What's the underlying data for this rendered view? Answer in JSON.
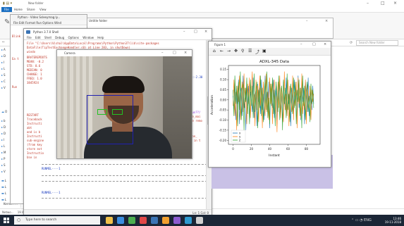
{
  "explorer": {
    "title": "New folder",
    "ribbon_tabs": [
      "File",
      "Home",
      "Share",
      "View"
    ],
    "search_placeholder": "Search New folder",
    "nav_items": [
      "A",
      "D",
      "I",
      "L",
      "S",
      "C",
      "V",
      "b",
      "D",
      "D",
      "I",
      "L",
      "M",
      "P",
      "S",
      "V",
      "O",
      "C",
      "D",
      "S",
      "L",
      "L",
      "L",
      "L",
      "L"
    ],
    "status_text": "19 items  1 item",
    "extra_labels": [
      "Kernel ???",
      "Netwo..."
    ]
  },
  "idle": {
    "title": "Python - Video Ssleeymag.ly...",
    "menu": "File  Edit  Format  Run  Options  Wind",
    "side_text": [
      "Blink",
      "Ea t",
      "Run"
    ]
  },
  "small_window": {
    "title": "Untitle folder"
  },
  "shell": {
    "title": "Python 3.7.0 Shell",
    "menu": [
      "File",
      "Edit",
      "Shell",
      "Debug",
      "Options",
      "Window",
      "Help"
    ],
    "lines": [
      "File \"C:\\Users\\Vishal\\AppData\\Local\\Programs\\Python\\Python37\\lib\\site-packages",
      "DataFile(TipTestExchangeHandler.c0) at Line 283, in shutDown)",
      "   windo",
      "BRATEREPDOTS",
      "MEAN: -0.2",
      "STD: 0.6",
      "MEDIAN: 0",
      "CHANGE: 1",
      "FREQ: 1.0",
      "3845924",
      "RESTART",
      "Traceback",
      "Instructi",
      "abt",
      "and is b",
      "Instructi",
      "sub-engine",
      "(from key",
      "store ext",
      "Instructio",
      "Use in",
      "RESTART: C",
      "RESTART: C"
    ],
    "right_fragments": [
      "el:-2.30",
      "bus??/",
      "le_mai",
      "he remo",
      "ion_",
      "s in t"
    ],
    "prompt_1": "RUNMEL----1",
    "prompt_2": "RUNMEL----1",
    "status": "Ln: 1  Col: 0"
  },
  "camera": {
    "title": "Camera"
  },
  "figure": {
    "title": "Figure 1",
    "toolbar_icons": [
      "home-icon",
      "back-icon",
      "forward-icon",
      "pan-icon",
      "zoom-icon",
      "configure-icon",
      "edit-curve-icon",
      "save-icon"
    ],
    "toolbar_glyphs": [
      "⌂",
      "←",
      "→",
      "✥",
      "⚲",
      "☰",
      "⤴",
      "▣"
    ]
  },
  "chart_data": {
    "type": "line",
    "title": "ADXL-345 Data",
    "xlabel": "Instant",
    "ylabel": "Acceleration",
    "xlim": [
      -5,
      95
    ],
    "ylim": [
      -0.22,
      0.17
    ],
    "xticks": [
      0,
      20,
      40,
      60,
      80
    ],
    "yticks": [
      -0.2,
      -0.15,
      -0.1,
      -0.05,
      0.0,
      0.05,
      0.1,
      0.15
    ],
    "ytick_labels": [
      "-0.20",
      "-0.15",
      "-0.10",
      "-0.05",
      "0.00",
      "0.05",
      "0.10",
      "0.15"
    ],
    "legend_position": "bottom-left",
    "series": [
      {
        "name": "x",
        "color": "#1f77b4",
        "values": [
          0.02,
          -0.05,
          0.08,
          -0.1,
          0.05,
          -0.02,
          0.1,
          -0.12,
          0.03,
          0.06,
          -0.08,
          0.12,
          -0.04,
          0.01,
          -0.15,
          0.09,
          -0.03,
          0.07,
          -0.11,
          0.04,
          0.0,
          -0.06,
          0.11,
          -0.09,
          0.02,
          0.05,
          -0.13,
          0.08,
          -0.01,
          0.06,
          -0.07,
          0.1,
          -0.05,
          0.03,
          -0.1,
          0.12,
          -0.02,
          0.04,
          -0.08,
          0.09,
          -0.14,
          0.06,
          0.01,
          -0.04,
          0.1,
          -0.09,
          0.03,
          0.07,
          -0.12,
          0.05,
          -0.01,
          0.08,
          -0.06,
          0.02,
          -0.11,
          0.09,
          0.0,
          -0.05,
          0.11,
          -0.08,
          0.04,
          -0.02,
          0.07,
          -0.13,
          0.06,
          0.01,
          -0.07,
          0.1,
          -0.03,
          0.05,
          -0.09,
          0.12,
          -0.04,
          0.02,
          -0.1,
          0.08,
          -0.01,
          0.06,
          -0.12,
          0.09,
          0.03,
          -0.06,
          0.11,
          -0.08,
          0.04,
          0.0,
          -0.05,
          0.07,
          -0.02
        ]
      },
      {
        "name": "y",
        "color": "#ff7f0e",
        "values": [
          -0.03,
          0.1,
          -0.08,
          0.04,
          -0.15,
          0.07,
          -0.01,
          0.12,
          -0.1,
          0.02,
          0.09,
          -0.06,
          0.13,
          -0.04,
          0.06,
          -0.12,
          0.08,
          -0.02,
          0.11,
          -0.09,
          0.05,
          0.14,
          -0.07,
          0.03,
          -0.13,
          0.1,
          -0.05,
          0.07,
          -0.11,
          0.12,
          -0.03,
          0.06,
          -0.14,
          0.09,
          0.01,
          -0.08,
          0.13,
          -0.06,
          0.04,
          -0.1,
          0.11,
          -0.02,
          0.08,
          -0.12,
          0.05,
          0.1,
          -0.07,
          0.02,
          -0.16,
          0.09,
          -0.04,
          0.12,
          -0.09,
          0.06,
          0.01,
          -0.11,
          0.14,
          -0.05,
          0.03,
          -0.08,
          0.1,
          -0.13,
          0.07,
          0.0,
          -0.06,
          0.12,
          -0.1,
          0.04,
          -0.03,
          0.09,
          -0.14,
          0.11,
          -0.02,
          0.06,
          -0.09,
          0.13,
          -0.07,
          0.02,
          -0.05,
          0.1,
          -0.12,
          0.08,
          0.01,
          -0.04,
          0.07,
          -0.1,
          0.05,
          -0.01,
          0.03
        ]
      },
      {
        "name": "z",
        "color": "#2ca02c",
        "values": [
          0.05,
          -0.08,
          0.12,
          -0.02,
          0.07,
          -0.13,
          0.09,
          -0.05,
          0.14,
          -0.1,
          0.03,
          0.08,
          -0.15,
          0.06,
          -0.01,
          0.11,
          -0.07,
          0.04,
          -0.12,
          0.1,
          -0.03,
          0.07,
          -0.09,
          0.13,
          -0.06,
          0.02,
          0.09,
          -0.14,
          0.05,
          -0.04,
          0.12,
          -0.08,
          0.06,
          -0.11,
          0.03,
          0.1,
          -0.05,
          0.14,
          -0.09,
          0.01,
          -0.12,
          0.08,
          -0.03,
          0.11,
          -0.07,
          0.05,
          -0.13,
          0.09,
          0.02,
          -0.06,
          0.12,
          -0.1,
          0.04,
          0.07,
          -0.15,
          0.1,
          -0.02,
          0.06,
          -0.09,
          0.13,
          -0.05,
          0.03,
          -0.11,
          0.08,
          0.0,
          -0.07,
          0.11,
          -0.04,
          0.09,
          -0.12,
          0.05,
          -0.01,
          0.1,
          -0.08,
          0.06,
          -0.14,
          0.12,
          -0.03,
          0.07,
          -0.1,
          0.04,
          0.09,
          -0.06,
          0.02,
          -0.11,
          0.08,
          -0.02,
          0.05,
          -0.04
        ]
      }
    ]
  },
  "taskbar": {
    "search_placeholder": "Type here to search",
    "time": "13:46",
    "date": "19-11-2018",
    "lang": "ENG",
    "app_colors": [
      "#f0c14b",
      "#3b8ee0",
      "#4caf50",
      "#e04848",
      "#3b74b5",
      "#f0a030",
      "#8c5cd0",
      "#2e9ad0",
      "#d0d0d0"
    ]
  }
}
